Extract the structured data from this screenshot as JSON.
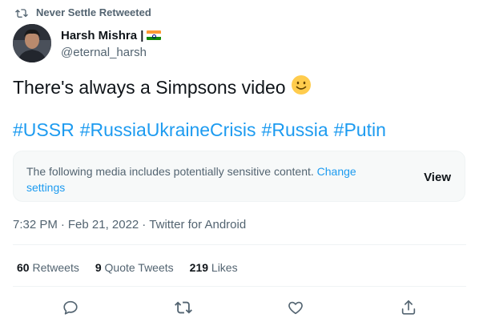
{
  "retweet": {
    "icon": "retweet-icon",
    "label": "Never Settle Retweeted"
  },
  "author": {
    "name": "Harsh Mishra |",
    "flag": "flag-india-icon",
    "handle": "@eternal_harsh",
    "avatar": "avatar"
  },
  "tweet": {
    "text": "There's always a Simpsons video",
    "emoji": "slightly-smiling-face-icon",
    "hashtags": [
      "#USSR",
      "#RussiaUkraineCrisis",
      "#Russia",
      "#Putin"
    ]
  },
  "sensitive": {
    "message": "The following media includes potentially sensitive content.",
    "link": "Change settings",
    "button": "View"
  },
  "meta": {
    "time": "7:32 PM",
    "separator": "·",
    "date": "Feb 21, 2022",
    "source": "Twitter for Android"
  },
  "stats": [
    {
      "count": "60",
      "label": "Retweets"
    },
    {
      "count": "9",
      "label": "Quote Tweets"
    },
    {
      "count": "219",
      "label": "Likes"
    }
  ],
  "actions": [
    "reply-icon",
    "retweet-icon",
    "like-icon",
    "share-icon"
  ],
  "colors": {
    "accent": "#1d9bf0",
    "text": "#0f1419",
    "secondary": "#536471",
    "border": "#eff3f4"
  }
}
